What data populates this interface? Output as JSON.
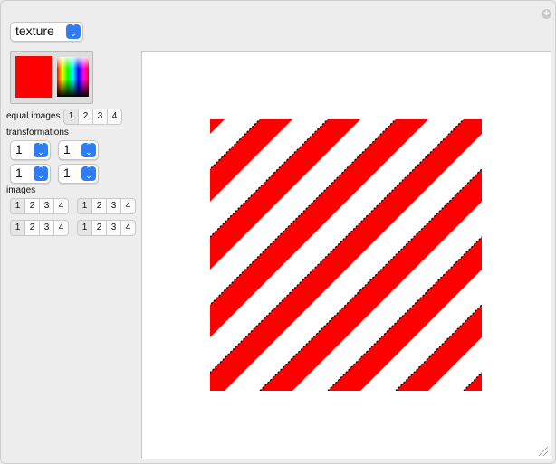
{
  "controls": {
    "mode_select": {
      "value": "texture"
    },
    "color": {
      "selected": "#ff0000"
    },
    "equal_images": {
      "label": "equal images",
      "options": [
        "1",
        "2",
        "3",
        "4"
      ],
      "selected": "1"
    },
    "transformations": {
      "label": "transformations",
      "selects": [
        "1",
        "1",
        "1",
        "1"
      ]
    },
    "images": {
      "label": "images",
      "groups": [
        {
          "options": [
            "1",
            "2",
            "3",
            "4"
          ],
          "selected": "1"
        },
        {
          "options": [
            "1",
            "2",
            "3",
            "4"
          ],
          "selected": "1"
        },
        {
          "options": [
            "1",
            "2",
            "3",
            "4"
          ],
          "selected": "1"
        },
        {
          "options": [
            "1",
            "2",
            "3",
            "4"
          ],
          "selected": "1"
        }
      ]
    }
  },
  "display": {
    "pattern": "diagonal-stripes",
    "stripe_color": "#ff0000",
    "background_color": "#ffffff",
    "edge_color": "#000000"
  },
  "icons": {
    "add": "plus-icon",
    "select_arrows": "chevron-up-down-icon",
    "resize": "resize-grip-icon"
  }
}
